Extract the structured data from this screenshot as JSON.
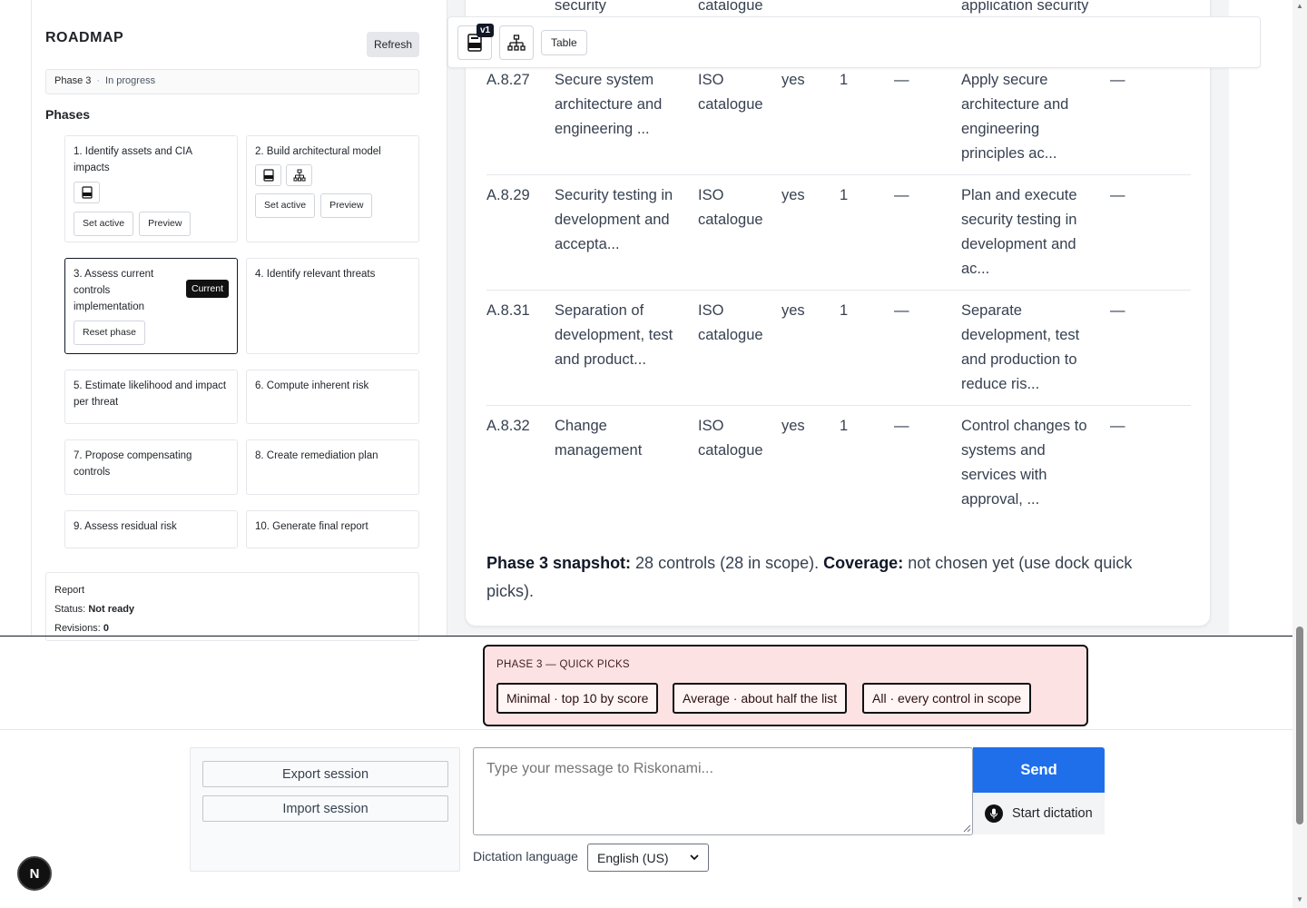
{
  "roadmap": {
    "title": "ROADMAP",
    "refresh_label": "Refresh",
    "phase_label": "Phase 3",
    "phase_status": "In progress",
    "phases_heading": "Phases",
    "cards": [
      {
        "title": "1. Identify assets and CIA impacts",
        "set_active": "Set active",
        "preview": "Preview"
      },
      {
        "title": "2. Build architectural model",
        "set_active": "Set active",
        "preview": "Preview"
      },
      {
        "title": "3. Assess current controls implementation",
        "badge": "Current",
        "reset": "Reset phase"
      },
      {
        "title": "4. Identify relevant threats"
      },
      {
        "title": "5. Estimate likelihood and impact per threat"
      },
      {
        "title": "6. Compute inherent risk"
      },
      {
        "title": "7. Propose compensating controls"
      },
      {
        "title": "8. Create remediation plan"
      },
      {
        "title": "9. Assess residual risk"
      },
      {
        "title": "10. Generate final report"
      }
    ],
    "report": {
      "title": "Report",
      "status_label": "Status:",
      "status_value": "Not ready",
      "revisions_label": "Revisions:",
      "revisions_value": "0"
    }
  },
  "toolbar": {
    "version_badge": "v1",
    "table_label": "Table"
  },
  "table": {
    "partial_top": {
      "name": "security",
      "source": "catalogue",
      "desc": "application security"
    },
    "rows": [
      {
        "id": "A.8.27",
        "name": "Secure system architecture and engineering ...",
        "source": "ISO catalogue",
        "applicable": "yes",
        "count": "1",
        "dash": "—",
        "desc": "Apply secure architecture and engineering principles ac...",
        "dash2": "—"
      },
      {
        "id": "A.8.29",
        "name": "Security testing in development and accepta...",
        "source": "ISO catalogue",
        "applicable": "yes",
        "count": "1",
        "dash": "—",
        "desc": "Plan and execute security testing in development and ac...",
        "dash2": "—"
      },
      {
        "id": "A.8.31",
        "name": "Separation of development, test and product...",
        "source": "ISO catalogue",
        "applicable": "yes",
        "count": "1",
        "dash": "—",
        "desc": "Separate development, test and production to reduce ris...",
        "dash2": "—"
      },
      {
        "id": "A.8.32",
        "name": "Change management",
        "source": "ISO catalogue",
        "applicable": "yes",
        "count": "1",
        "dash": "—",
        "desc": "Control changes to systems and services with approval, ...",
        "dash2": "—"
      }
    ]
  },
  "snapshot": {
    "label": "Phase 3 snapshot:",
    "text": " 28 controls (28 in scope). ",
    "coverage_label": "Coverage:",
    "coverage_text": " not chosen yet (use dock quick picks)."
  },
  "quick_picks": {
    "title": "PHASE 3 — QUICK PICKS",
    "options": [
      "Minimal · top 10 by score",
      "Average · about half the list",
      "All · every control in scope"
    ]
  },
  "session": {
    "export_label": "Export session",
    "import_label": "Import session"
  },
  "composer": {
    "placeholder": "Type your message to Riskonami...",
    "send_label": "Send",
    "dictation_label": "Start dictation",
    "language_label": "Dictation language",
    "language_value": "English (US)"
  },
  "n_badge": "N",
  "colors": {
    "accent": "#1f6feb",
    "quick_picks_bg": "#fde2e4",
    "current_badge": "#111111"
  }
}
